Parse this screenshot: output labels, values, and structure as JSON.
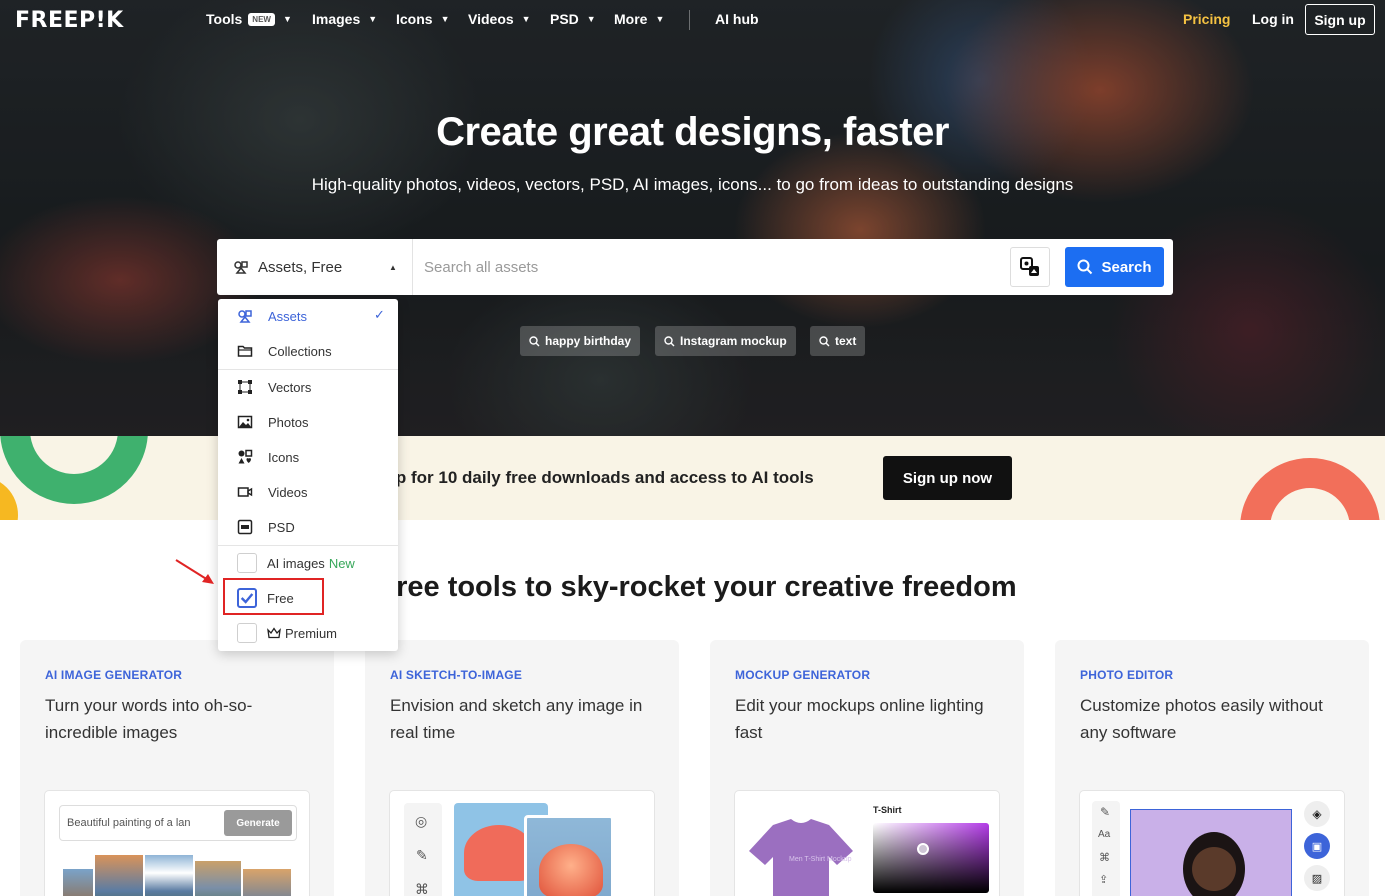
{
  "nav": {
    "logo": "FREEP!K",
    "items": [
      {
        "label": "Tools",
        "badge": "NEW"
      },
      {
        "label": "Images"
      },
      {
        "label": "Icons"
      },
      {
        "label": "Videos"
      },
      {
        "label": "PSD"
      },
      {
        "label": "More"
      }
    ],
    "ai_hub": "AI hub",
    "pricing": "Pricing",
    "login": "Log in",
    "signup": "Sign up"
  },
  "hero": {
    "title": "Create great designs, faster",
    "subtitle": "High-quality photos, videos, vectors, PSD, AI images, icons... to go from ideas to outstanding designs"
  },
  "search": {
    "selected_filter": "Assets, Free",
    "placeholder": "Search all assets",
    "button": "Search",
    "suggestions": [
      "happy birthday",
      "Instagram mockup",
      "text"
    ]
  },
  "dropdown": {
    "items": [
      {
        "label": "Assets",
        "icon": "assets-icon",
        "selected": true
      },
      {
        "label": "Collections",
        "icon": "folder-icon"
      },
      {
        "label": "Vectors",
        "icon": "vector-icon"
      },
      {
        "label": "Photos",
        "icon": "photo-icon"
      },
      {
        "label": "Icons",
        "icon": "icons-icon"
      },
      {
        "label": "Videos",
        "icon": "video-icon"
      },
      {
        "label": "PSD",
        "icon": "psd-icon"
      }
    ],
    "filters": [
      {
        "label": "AI images",
        "tag": "New",
        "checked": false
      },
      {
        "label": "Free",
        "checked": true
      },
      {
        "label": "Premium",
        "icon": "crown-icon",
        "checked": false
      }
    ]
  },
  "banner": {
    "text": "gn up for 10 daily free downloads and access to AI tools",
    "button": "Sign up now"
  },
  "section": {
    "title": "Free tools to sky-rocket your creative freedom"
  },
  "cards": [
    {
      "kicker": "AI IMAGE GENERATOR",
      "desc": "Turn your words into oh-so-incredible images",
      "input_text": "Beautiful painting of a lan",
      "button": "Generate"
    },
    {
      "kicker": "AI SKETCH-TO-IMAGE",
      "desc": "Envision and sketch any image in real time"
    },
    {
      "kicker": "MOCKUP GENERATOR",
      "desc": "Edit your mockups online lighting fast",
      "label": "T-Shirt",
      "shirt_text": "Men T-Shirt Mockup"
    },
    {
      "kicker": "PHOTO EDITOR",
      "desc": "Customize photos easily without any software",
      "tool_label": "Aa"
    }
  ],
  "colors": {
    "accent": "#1c6ef2",
    "kicker": "#3d64d9",
    "pricing": "#f5c242",
    "highlight": "#e02424",
    "green_shape": "#3fb16e",
    "coral_shape": "#f26f5a",
    "yellow_shape": "#f6b821"
  }
}
